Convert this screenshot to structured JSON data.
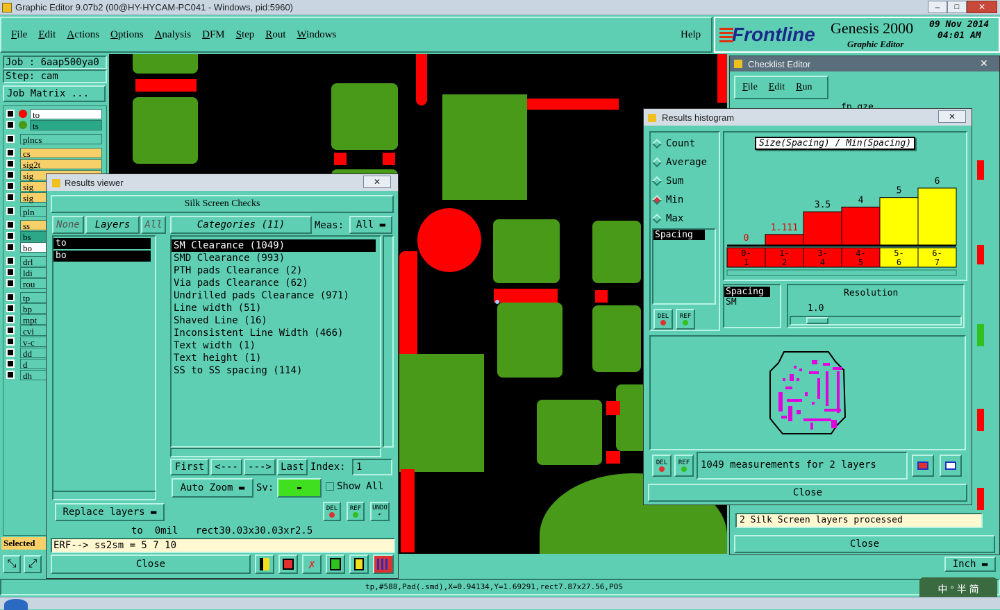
{
  "window": {
    "title": "Graphic Editor 9.07b2 (00@HY-HYCAM-PC041 - Windows, pid:5960)"
  },
  "menu": [
    "File",
    "Edit",
    "Actions",
    "Options",
    "Analysis",
    "DFM",
    "Step",
    "Rout",
    "Windows"
  ],
  "help": "Help",
  "brand": {
    "logo": "Frontline",
    "product": "Genesis 2000",
    "subtitle": "Graphic Editor",
    "date": "09 Nov 2014",
    "time": "04:01 AM"
  },
  "job": {
    "job": "Job : 6aap500ya0",
    "step": "Step: cam",
    "matrix": "Job Matrix ..."
  },
  "layers": [
    {
      "name": "to",
      "color": "#ffffff",
      "dot": "#ff0000"
    },
    {
      "name": "ts",
      "color": "#2aa888",
      "dot": "#4a9a1a"
    },
    {
      "name": "plncs",
      "color": "#5fcfb3"
    },
    {
      "name": "cs",
      "color": "#f7d06a"
    },
    {
      "name": "sig2t",
      "color": "#f7d06a"
    },
    {
      "name": "sig",
      "color": "#f7d06a"
    },
    {
      "name": "sig",
      "color": "#f7d06a"
    },
    {
      "name": "sig",
      "color": "#f7d06a"
    },
    {
      "name": "pln",
      "color": "#5fcfb3"
    },
    {
      "name": "ss",
      "color": "#f7d06a"
    },
    {
      "name": "bs",
      "color": "#2aa888"
    },
    {
      "name": "bo",
      "color": "#ffffff"
    },
    {
      "name": "drl",
      "color": "#5fcfb3"
    },
    {
      "name": "ldi",
      "color": "#5fcfb3"
    },
    {
      "name": "rou",
      "color": "#5fcfb3"
    },
    {
      "name": "tp",
      "color": "#5fcfb3"
    },
    {
      "name": "bp",
      "color": "#5fcfb3"
    },
    {
      "name": "mpt",
      "color": "#5fcfb3"
    },
    {
      "name": "cvi",
      "color": "#5fcfb3"
    },
    {
      "name": "v-c",
      "color": "#5fcfb3"
    },
    {
      "name": "dd",
      "color": "#5fcfb3"
    },
    {
      "name": "d",
      "color": "#5fcfb3"
    },
    {
      "name": "dh",
      "color": "#5fcfb3"
    }
  ],
  "selected_label": "Selected",
  "results_viewer": {
    "title": "Results viewer",
    "heading": "Silk Screen Checks",
    "none": "None",
    "layers": "Layers",
    "all": "All",
    "categories": "Categories (11)",
    "meas_label": "Meas:",
    "meas_value": "All",
    "layer_list": [
      "to",
      "bo"
    ],
    "category_list": [
      "SM Clearance (1049)",
      "SMD Clearance (993)",
      "PTH pads Clearance (2)",
      "Via pads Clearance (62)",
      "Undrilled pads Clearance (971)",
      "Line width (51)",
      "Shaved Line (16)",
      "Inconsistent Line Width (466)",
      "Text width (1)",
      "Text height (1)",
      "SS to SS spacing (114)"
    ],
    "first": "First",
    "prev": "<---",
    "next": "--->",
    "last": "Last",
    "index_label": "Index:",
    "index_value": "1",
    "auto_zoom": "Auto Zoom",
    "sv": "Sv:",
    "show_all": "Show All",
    "replace_layers": "Replace layers",
    "del": "DEL",
    "ref": "REF",
    "undo": "UNDO",
    "info": "to  0mil   rect30.03x30.03xr2.5",
    "erf": "ERF--> ss2sm = 5 7 10",
    "close": "Close"
  },
  "checklist": {
    "title": "Checklist Editor",
    "menu": [
      "File",
      "Edit",
      "Run"
    ],
    "fp": "fp_gze",
    "status": "2 Silk Screen layers processed",
    "close": "Close"
  },
  "histogram": {
    "title": "Results histogram",
    "modes": [
      "Count",
      "Average",
      "Sum",
      "Min",
      "Max"
    ],
    "selected_mode": "Min",
    "list": [
      "Spacing"
    ],
    "chart_title": "Size(Spacing) / Min(Spacing)",
    "spacing_list": [
      "Spacing",
      "SM"
    ],
    "resolution_label": "Resolution",
    "resolution_value": "1.0",
    "measurements": "1049 measurements for 2 layers",
    "close": "Close"
  },
  "chart_data": {
    "type": "bar",
    "title": "Size(Spacing) / Min(Spacing)",
    "categories": [
      "0-\n1",
      "1-\n2",
      "3-\n4",
      "4-\n5",
      "5-\n6",
      "6-\n7"
    ],
    "values": [
      0,
      1.111,
      3.5,
      4,
      5,
      6
    ],
    "value_labels": [
      "0",
      "1.111",
      "3.5",
      "4",
      "5",
      "6"
    ],
    "colors": [
      "#ff0000",
      "#ff0000",
      "#ff0000",
      "#ff0000",
      "#ffff00",
      "#ffff00"
    ],
    "ylim": [
      0,
      6
    ]
  },
  "units": "Inch",
  "status_bar": "tp,#588,Pad(.smd),X=0.94134,Y=1.69291,rect7.87x27.56,POS",
  "ime": "中 ° 半 简"
}
